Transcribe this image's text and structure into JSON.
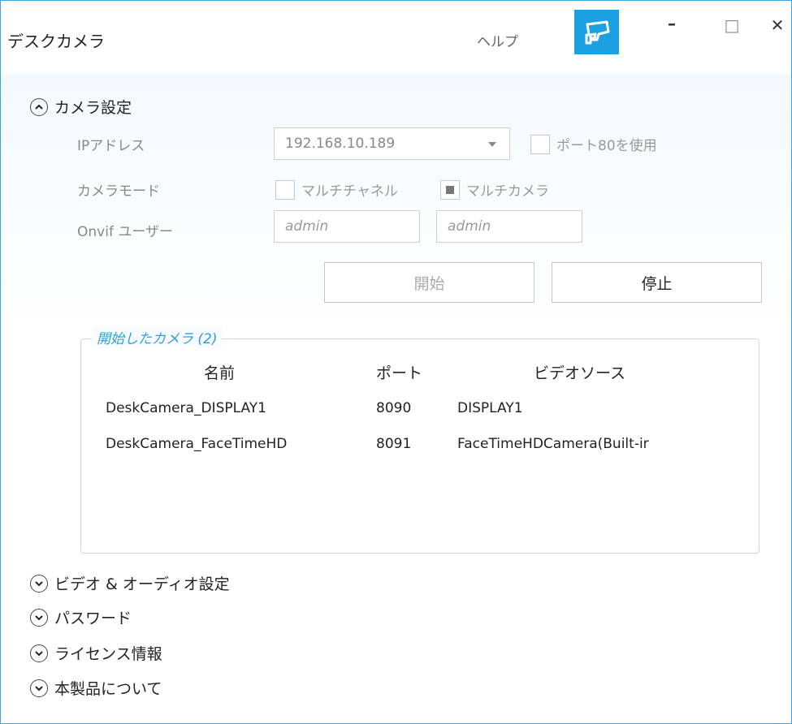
{
  "window": {
    "title": "デスクカメラ",
    "help": "ヘルプ",
    "minimize": "–",
    "maximize": "□",
    "close": "✕"
  },
  "camera_settings": {
    "header": "カメラ設定",
    "ip_label": "IPアドレス",
    "ip_value": "192.168.10.189",
    "port80_label": "ポート80を使用",
    "port80_checked": false,
    "mode_label": "カメラモード",
    "multichannel_label": "マルチチャネル",
    "multichannel_checked": false,
    "multicamera_label": "マルチカメラ",
    "multicamera_checked": true,
    "onvif_label": "Onvif ユーザー",
    "onvif_user": "admin",
    "onvif_password": "admin",
    "start_button": "開始",
    "stop_button": "停止"
  },
  "started_cameras": {
    "title": "開始したカメラ (2)",
    "columns": [
      "名前",
      "ポート",
      "ビデオソース"
    ],
    "rows": [
      [
        "DeskCamera_DISPLAY1",
        "8090",
        "DISPLAY1"
      ],
      [
        "DeskCamera_FaceTimeHD",
        "8091",
        "FaceTimeHDCamera(Built-ir"
      ]
    ]
  },
  "sections": [
    "ビデオ & オーディオ設定",
    "パスワード",
    "ライセンス情報",
    "本製品について"
  ],
  "colors": {
    "accent": "#1ba0e2",
    "border": "#3fa5e0",
    "group_title": "#2b9fe0"
  }
}
